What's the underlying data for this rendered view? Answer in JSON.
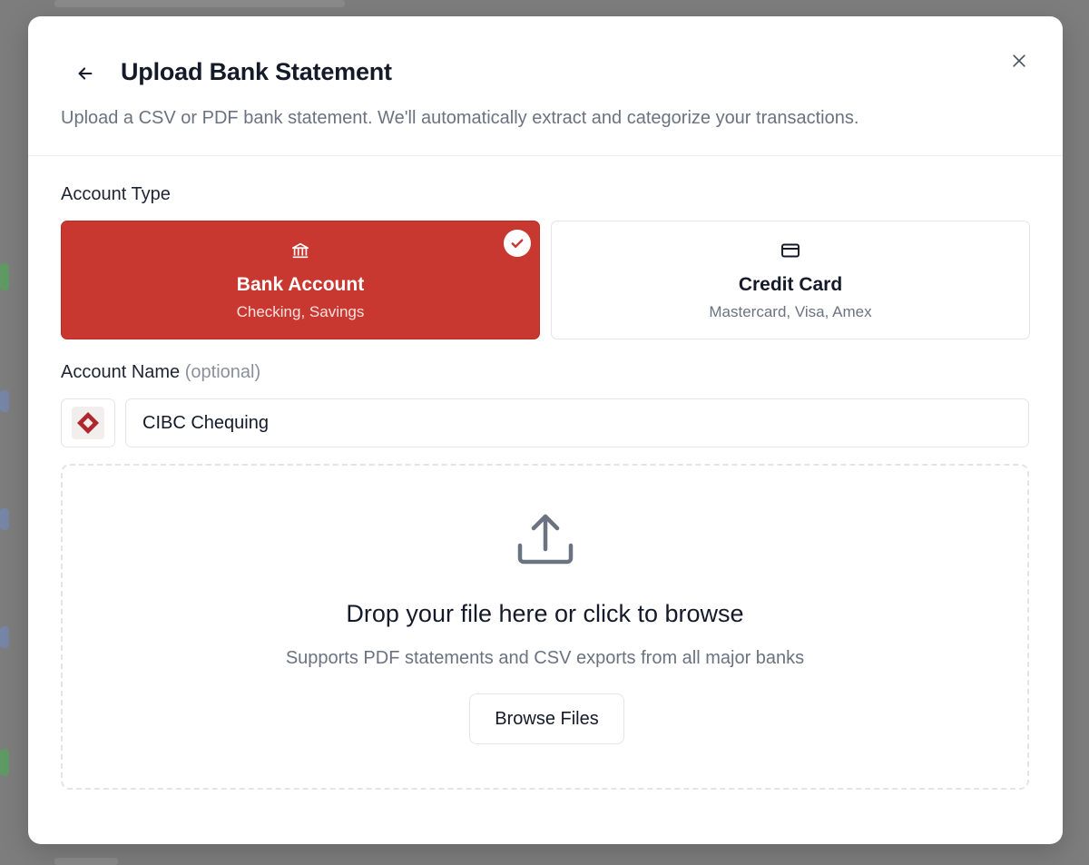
{
  "modal": {
    "title": "Upload Bank Statement",
    "subtitle": "Upload a CSV or PDF bank statement. We'll automatically extract and categorize your transactions."
  },
  "account_type": {
    "label": "Account Type",
    "options": [
      {
        "title": "Bank Account",
        "subtitle": "Checking, Savings",
        "icon": "bank-icon",
        "selected": true
      },
      {
        "title": "Credit Card",
        "subtitle": "Mastercard, Visa, Amex",
        "icon": "credit-card-icon",
        "selected": false
      }
    ]
  },
  "account_name": {
    "label": "Account Name",
    "optional_label": "(optional)",
    "value": "CIBC Chequing",
    "logo": "cibc-logo"
  },
  "dropzone": {
    "title": "Drop your file here or click to browse",
    "subtitle": "Supports PDF statements and CSV exports from all major banks",
    "button_label": "Browse Files"
  },
  "colors": {
    "accent": "#c93830",
    "cibc": "#b0262c"
  }
}
